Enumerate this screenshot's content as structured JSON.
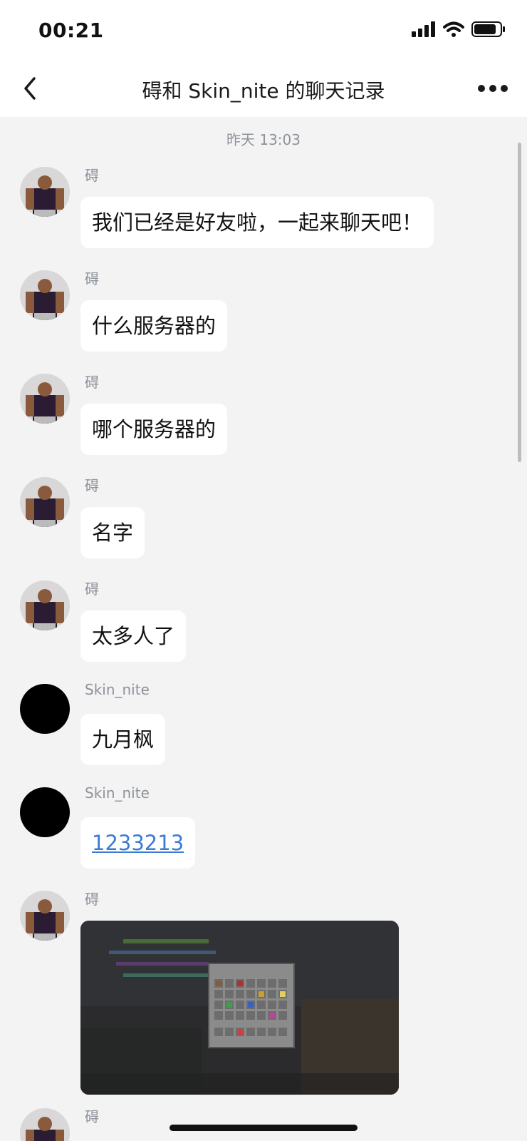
{
  "status": {
    "time": "00:21"
  },
  "nav": {
    "title": "碍和 Skin_nite 的聊天记录"
  },
  "chat": {
    "timestamp": "昨天 13:03",
    "messages": [
      {
        "sender": "碍",
        "text": "我们已经是好友啦，一起来聊天吧！",
        "avatar": "muscle-man-avatar"
      },
      {
        "sender": "碍",
        "text": "什么服务器的",
        "avatar": "muscle-man-avatar"
      },
      {
        "sender": "碍",
        "text": "哪个服务器的",
        "avatar": "muscle-man-avatar"
      },
      {
        "sender": "碍",
        "text": "名字",
        "avatar": "muscle-man-avatar"
      },
      {
        "sender": "碍",
        "text": "太多人了",
        "avatar": "muscle-man-avatar"
      },
      {
        "sender": "Skin_nite",
        "text": "九月枫",
        "avatar": "black-avatar"
      },
      {
        "sender": "Skin_nite",
        "text": "1233213",
        "avatar": "black-avatar",
        "is_link": true
      },
      {
        "sender": "碍",
        "type": "image",
        "image": "minecraft-inventory-screenshot",
        "avatar": "muscle-man-avatar"
      },
      {
        "sender": "碍",
        "avatar": "muscle-man-avatar"
      }
    ]
  },
  "colors": {
    "link": "#3a7bd5",
    "background": "#f3f3f4",
    "meta_text": "#8e929b"
  },
  "icons": [
    "back-chevron-icon",
    "more-dots-icon",
    "signal-icon",
    "wifi-icon",
    "battery-icon"
  ]
}
